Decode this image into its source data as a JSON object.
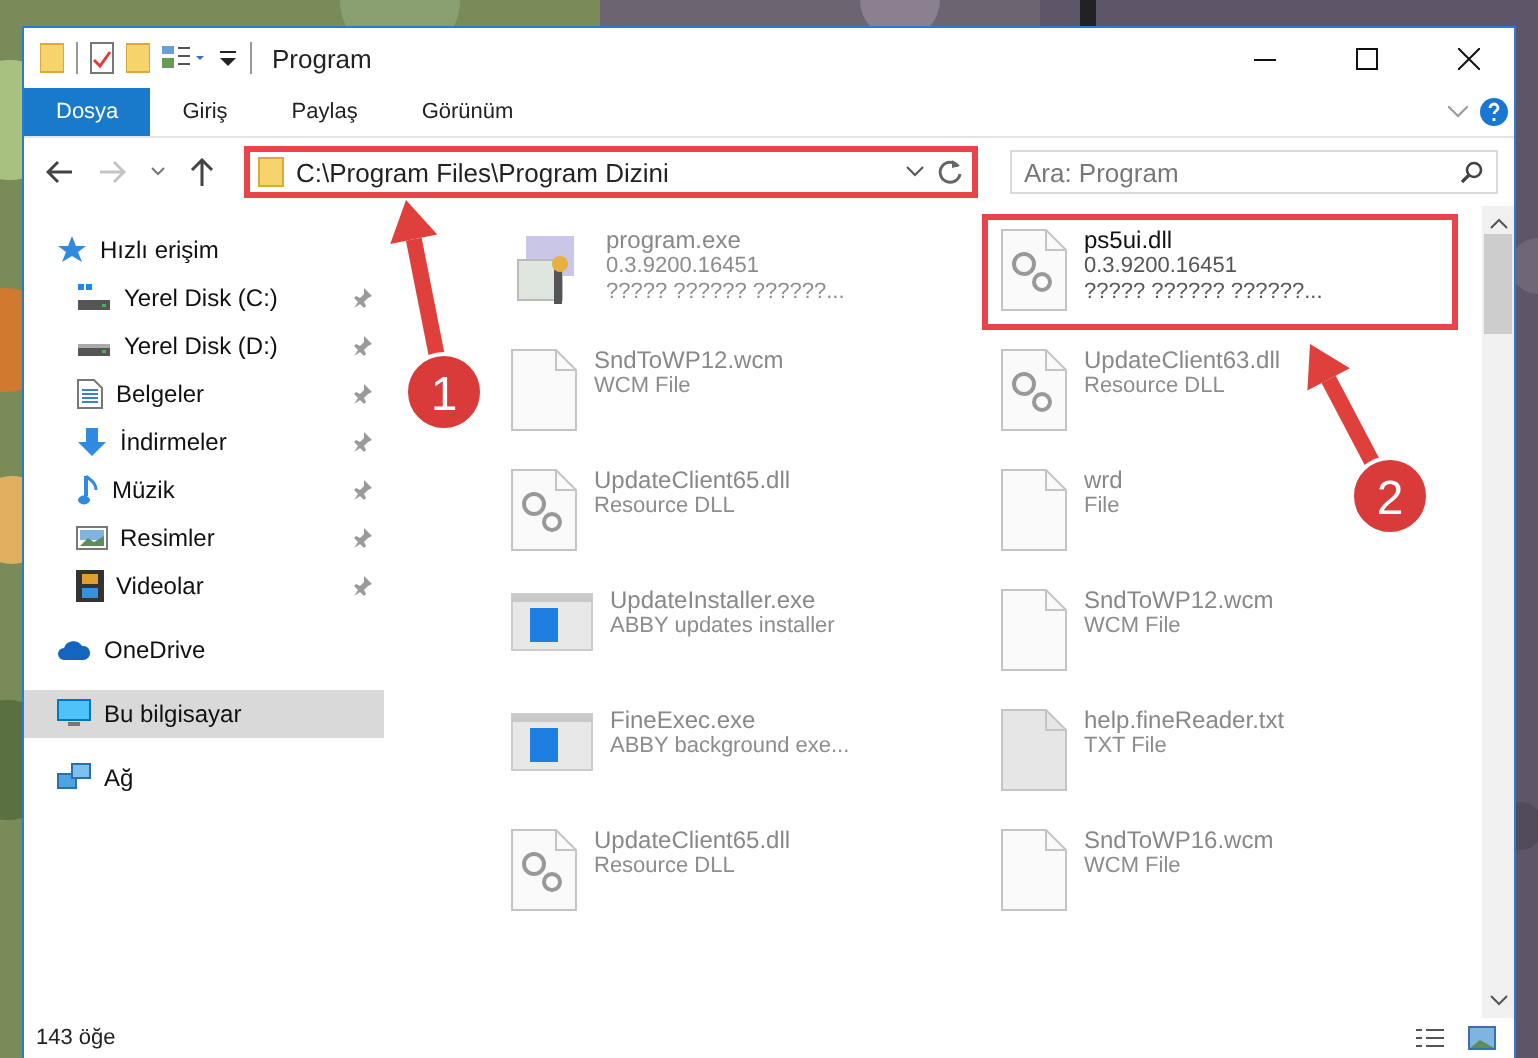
{
  "window": {
    "title": "Program"
  },
  "ribbon": {
    "tabs": [
      {
        "label": "Dosya",
        "kind": "file"
      },
      {
        "label": "Giriş",
        "kind": "tab"
      },
      {
        "label": "Paylaş",
        "kind": "tab"
      },
      {
        "label": "Görünüm",
        "kind": "tab"
      }
    ]
  },
  "nav": {
    "forward_disabled": true
  },
  "address": {
    "path": "C:\\Program Files\\Program Dizini",
    "highlighted": true
  },
  "search": {
    "placeholder": "Ara: Program"
  },
  "sidebar": {
    "items": [
      {
        "label": "Hızlı erişim",
        "kind": "star",
        "selected": false,
        "children": [
          {
            "label": "Yerel Disk (C:)",
            "kind": "system-drive",
            "pinned": true,
            "selected": false
          },
          {
            "label": "Yerel Disk (D:)",
            "kind": "drive",
            "pinned": true,
            "selected": false
          },
          {
            "label": "Belgeler",
            "kind": "documents",
            "pinned": true,
            "selected": false
          },
          {
            "label": "İndirmeler",
            "kind": "download",
            "pinned": true,
            "selected": false
          },
          {
            "label": "Müzik",
            "kind": "music",
            "pinned": true,
            "selected": false
          },
          {
            "label": "Resimler",
            "kind": "pictures",
            "pinned": true,
            "selected": false
          },
          {
            "label": "Videolar",
            "kind": "video",
            "pinned": true,
            "selected": false
          }
        ]
      },
      {
        "label": "OneDrive",
        "kind": "cloud",
        "selected": false
      },
      {
        "label": "Bu bilgisayar",
        "kind": "computer",
        "selected": true
      },
      {
        "label": "Ağ",
        "kind": "network",
        "selected": false
      }
    ]
  },
  "files": [
    {
      "name": "program.exe",
      "lines": [
        "0.3.9200.16451",
        "????? ?????? ??????..."
      ],
      "kind": "installer",
      "blurred": true,
      "highlighted": false
    },
    {
      "name": "ps5ui.dll",
      "lines": [
        "0.3.9200.16451",
        "????? ?????? ??????..."
      ],
      "kind": "dll",
      "blurred": false,
      "highlighted": true
    },
    {
      "name": "SndToWP12.wcm",
      "lines": [
        "WCM File"
      ],
      "kind": "blank",
      "blurred": true,
      "highlighted": false
    },
    {
      "name": "UpdateClient63.dll",
      "lines": [
        "Resource DLL"
      ],
      "kind": "dll",
      "blurred": true,
      "highlighted": false
    },
    {
      "name": "UpdateClient65.dll",
      "lines": [
        "Resource DLL"
      ],
      "kind": "dll",
      "blurred": true,
      "highlighted": false
    },
    {
      "name": "wrd",
      "lines": [
        "File"
      ],
      "kind": "blank",
      "blurred": true,
      "highlighted": false
    },
    {
      "name": "UpdateInstaller.exe",
      "lines": [
        "ABBY updates installer"
      ],
      "kind": "app",
      "blurred": true,
      "highlighted": false
    },
    {
      "name": "SndToWP12.wcm",
      "lines": [
        "WCM File"
      ],
      "kind": "blank",
      "blurred": true,
      "highlighted": false
    },
    {
      "name": "FineExec.exe",
      "lines": [
        "ABBY background exe..."
      ],
      "kind": "app",
      "blurred": true,
      "highlighted": false
    },
    {
      "name": "help.fineReader.txt",
      "lines": [
        "TXT File"
      ],
      "kind": "text",
      "blurred": true,
      "highlighted": false
    },
    {
      "name": "UpdateClient65.dll",
      "lines": [
        "Resource DLL"
      ],
      "kind": "dll",
      "blurred": true,
      "highlighted": false
    },
    {
      "name": "SndToWP16.wcm",
      "lines": [
        "WCM File"
      ],
      "kind": "blank",
      "blurred": true,
      "highlighted": false
    }
  ],
  "annotations": [
    {
      "label": "1"
    },
    {
      "label": "2"
    }
  ],
  "status_bar": {
    "count": "143 öğe"
  }
}
